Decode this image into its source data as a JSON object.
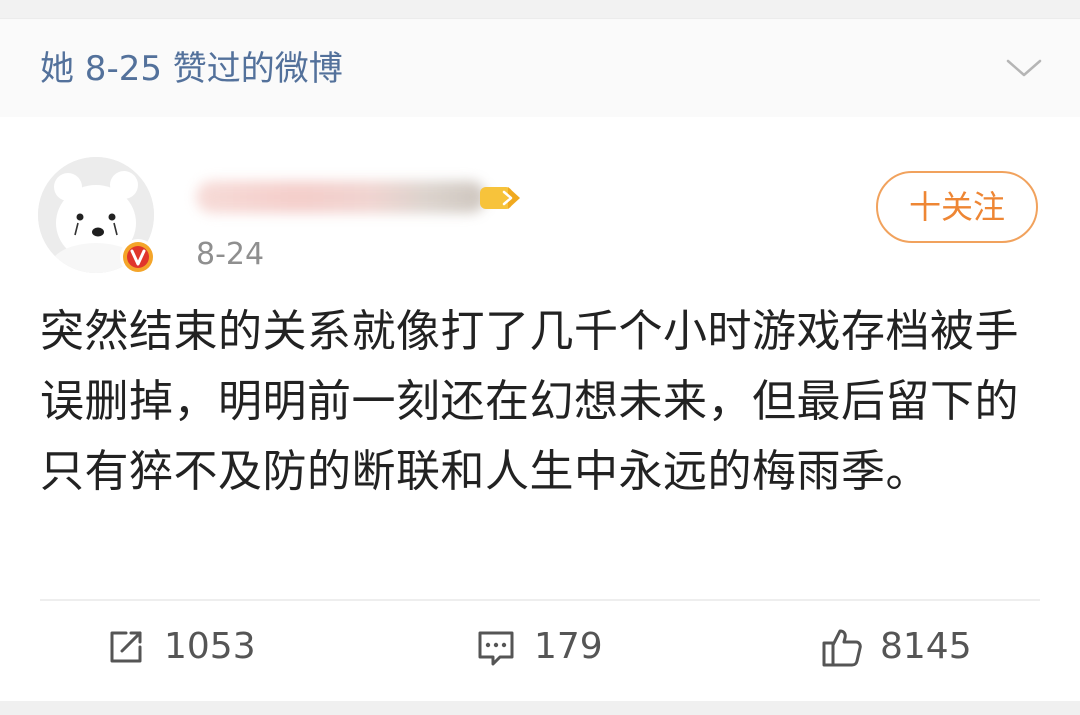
{
  "header": {
    "title": "她 8-25 赞过的微博",
    "chevron_icon": "chevron-down-icon"
  },
  "post": {
    "avatar_icon": "polar-bear-avatar",
    "verified_badge": "v",
    "vip_icon": "vip-member-icon",
    "date": "8-24",
    "follow_label": "十关注",
    "text": "突然结束的关系就像打了几千个小时游戏存档被手误删掉，明明前一刻还在幻想未来，但最后留下的只有猝不及防的断联和人生中永远的梅雨季。"
  },
  "actions": {
    "repost": {
      "icon": "repost-icon",
      "count": "1053"
    },
    "comment": {
      "icon": "comment-icon",
      "count": "179"
    },
    "like": {
      "icon": "thumbs-up-icon",
      "count": "8145"
    }
  },
  "colors": {
    "accent_blue": "#53719b",
    "follow_orange": "#ee8634",
    "text_dark": "#222222",
    "meta_gray": "#8f8f8f"
  }
}
